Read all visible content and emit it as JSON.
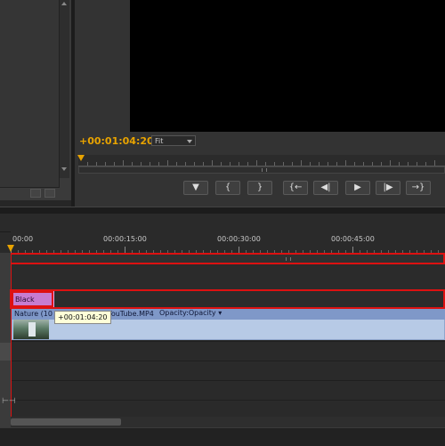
{
  "monitor": {
    "timecode": "+00:01:04:20",
    "zoom": "Fit",
    "transport": [
      {
        "name": "add-marker-button",
        "icon": "marker-icon",
        "glyph": "▼"
      },
      {
        "name": "mark-in-button",
        "icon": "mark-in-icon",
        "glyph": "{"
      },
      {
        "name": "mark-out-button",
        "icon": "mark-out-icon",
        "glyph": "}"
      },
      {
        "name": "go-to-in-button",
        "icon": "go-to-in-icon",
        "glyph": "{←"
      },
      {
        "name": "step-back-button",
        "icon": "step-back-icon",
        "glyph": "◀|"
      },
      {
        "name": "play-button",
        "icon": "play-icon",
        "glyph": "▶"
      },
      {
        "name": "step-forward-button",
        "icon": "step-forward-icon",
        "glyph": "|▶"
      },
      {
        "name": "go-to-out-button",
        "icon": "go-to-out-icon",
        "glyph": "→}"
      }
    ]
  },
  "timeline": {
    "ruler_labels": [
      "00:00",
      "00:00:15:00",
      "00:00:30:00",
      "00:00:45:00"
    ],
    "clips": {
      "black_video": "Black Video",
      "nature_name": "Nature (10",
      "nature_suffix": "YouTube.MP4",
      "opacity": "Opacity:Opacity"
    },
    "tooltip": "+00:01:04:20",
    "playhead_color": "#dd1111",
    "accent": "#e8a300"
  }
}
